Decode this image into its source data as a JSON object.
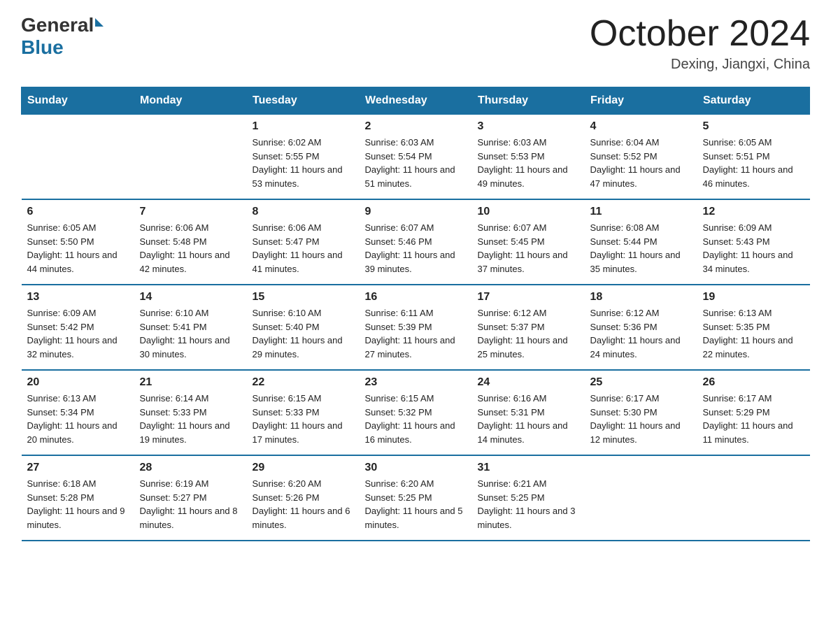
{
  "logo": {
    "general": "General",
    "blue": "Blue",
    "triangle": ""
  },
  "header": {
    "title": "October 2024",
    "subtitle": "Dexing, Jiangxi, China"
  },
  "days_of_week": [
    "Sunday",
    "Monday",
    "Tuesday",
    "Wednesday",
    "Thursday",
    "Friday",
    "Saturday"
  ],
  "weeks": [
    [
      {
        "day": "",
        "sunrise": "",
        "sunset": "",
        "daylight": ""
      },
      {
        "day": "",
        "sunrise": "",
        "sunset": "",
        "daylight": ""
      },
      {
        "day": "1",
        "sunrise": "Sunrise: 6:02 AM",
        "sunset": "Sunset: 5:55 PM",
        "daylight": "Daylight: 11 hours and 53 minutes."
      },
      {
        "day": "2",
        "sunrise": "Sunrise: 6:03 AM",
        "sunset": "Sunset: 5:54 PM",
        "daylight": "Daylight: 11 hours and 51 minutes."
      },
      {
        "day": "3",
        "sunrise": "Sunrise: 6:03 AM",
        "sunset": "Sunset: 5:53 PM",
        "daylight": "Daylight: 11 hours and 49 minutes."
      },
      {
        "day": "4",
        "sunrise": "Sunrise: 6:04 AM",
        "sunset": "Sunset: 5:52 PM",
        "daylight": "Daylight: 11 hours and 47 minutes."
      },
      {
        "day": "5",
        "sunrise": "Sunrise: 6:05 AM",
        "sunset": "Sunset: 5:51 PM",
        "daylight": "Daylight: 11 hours and 46 minutes."
      }
    ],
    [
      {
        "day": "6",
        "sunrise": "Sunrise: 6:05 AM",
        "sunset": "Sunset: 5:50 PM",
        "daylight": "Daylight: 11 hours and 44 minutes."
      },
      {
        "day": "7",
        "sunrise": "Sunrise: 6:06 AM",
        "sunset": "Sunset: 5:48 PM",
        "daylight": "Daylight: 11 hours and 42 minutes."
      },
      {
        "day": "8",
        "sunrise": "Sunrise: 6:06 AM",
        "sunset": "Sunset: 5:47 PM",
        "daylight": "Daylight: 11 hours and 41 minutes."
      },
      {
        "day": "9",
        "sunrise": "Sunrise: 6:07 AM",
        "sunset": "Sunset: 5:46 PM",
        "daylight": "Daylight: 11 hours and 39 minutes."
      },
      {
        "day": "10",
        "sunrise": "Sunrise: 6:07 AM",
        "sunset": "Sunset: 5:45 PM",
        "daylight": "Daylight: 11 hours and 37 minutes."
      },
      {
        "day": "11",
        "sunrise": "Sunrise: 6:08 AM",
        "sunset": "Sunset: 5:44 PM",
        "daylight": "Daylight: 11 hours and 35 minutes."
      },
      {
        "day": "12",
        "sunrise": "Sunrise: 6:09 AM",
        "sunset": "Sunset: 5:43 PM",
        "daylight": "Daylight: 11 hours and 34 minutes."
      }
    ],
    [
      {
        "day": "13",
        "sunrise": "Sunrise: 6:09 AM",
        "sunset": "Sunset: 5:42 PM",
        "daylight": "Daylight: 11 hours and 32 minutes."
      },
      {
        "day": "14",
        "sunrise": "Sunrise: 6:10 AM",
        "sunset": "Sunset: 5:41 PM",
        "daylight": "Daylight: 11 hours and 30 minutes."
      },
      {
        "day": "15",
        "sunrise": "Sunrise: 6:10 AM",
        "sunset": "Sunset: 5:40 PM",
        "daylight": "Daylight: 11 hours and 29 minutes."
      },
      {
        "day": "16",
        "sunrise": "Sunrise: 6:11 AM",
        "sunset": "Sunset: 5:39 PM",
        "daylight": "Daylight: 11 hours and 27 minutes."
      },
      {
        "day": "17",
        "sunrise": "Sunrise: 6:12 AM",
        "sunset": "Sunset: 5:37 PM",
        "daylight": "Daylight: 11 hours and 25 minutes."
      },
      {
        "day": "18",
        "sunrise": "Sunrise: 6:12 AM",
        "sunset": "Sunset: 5:36 PM",
        "daylight": "Daylight: 11 hours and 24 minutes."
      },
      {
        "day": "19",
        "sunrise": "Sunrise: 6:13 AM",
        "sunset": "Sunset: 5:35 PM",
        "daylight": "Daylight: 11 hours and 22 minutes."
      }
    ],
    [
      {
        "day": "20",
        "sunrise": "Sunrise: 6:13 AM",
        "sunset": "Sunset: 5:34 PM",
        "daylight": "Daylight: 11 hours and 20 minutes."
      },
      {
        "day": "21",
        "sunrise": "Sunrise: 6:14 AM",
        "sunset": "Sunset: 5:33 PM",
        "daylight": "Daylight: 11 hours and 19 minutes."
      },
      {
        "day": "22",
        "sunrise": "Sunrise: 6:15 AM",
        "sunset": "Sunset: 5:33 PM",
        "daylight": "Daylight: 11 hours and 17 minutes."
      },
      {
        "day": "23",
        "sunrise": "Sunrise: 6:15 AM",
        "sunset": "Sunset: 5:32 PM",
        "daylight": "Daylight: 11 hours and 16 minutes."
      },
      {
        "day": "24",
        "sunrise": "Sunrise: 6:16 AM",
        "sunset": "Sunset: 5:31 PM",
        "daylight": "Daylight: 11 hours and 14 minutes."
      },
      {
        "day": "25",
        "sunrise": "Sunrise: 6:17 AM",
        "sunset": "Sunset: 5:30 PM",
        "daylight": "Daylight: 11 hours and 12 minutes."
      },
      {
        "day": "26",
        "sunrise": "Sunrise: 6:17 AM",
        "sunset": "Sunset: 5:29 PM",
        "daylight": "Daylight: 11 hours and 11 minutes."
      }
    ],
    [
      {
        "day": "27",
        "sunrise": "Sunrise: 6:18 AM",
        "sunset": "Sunset: 5:28 PM",
        "daylight": "Daylight: 11 hours and 9 minutes."
      },
      {
        "day": "28",
        "sunrise": "Sunrise: 6:19 AM",
        "sunset": "Sunset: 5:27 PM",
        "daylight": "Daylight: 11 hours and 8 minutes."
      },
      {
        "day": "29",
        "sunrise": "Sunrise: 6:20 AM",
        "sunset": "Sunset: 5:26 PM",
        "daylight": "Daylight: 11 hours and 6 minutes."
      },
      {
        "day": "30",
        "sunrise": "Sunrise: 6:20 AM",
        "sunset": "Sunset: 5:25 PM",
        "daylight": "Daylight: 11 hours and 5 minutes."
      },
      {
        "day": "31",
        "sunrise": "Sunrise: 6:21 AM",
        "sunset": "Sunset: 5:25 PM",
        "daylight": "Daylight: 11 hours and 3 minutes."
      },
      {
        "day": "",
        "sunrise": "",
        "sunset": "",
        "daylight": ""
      },
      {
        "day": "",
        "sunrise": "",
        "sunset": "",
        "daylight": ""
      }
    ]
  ]
}
